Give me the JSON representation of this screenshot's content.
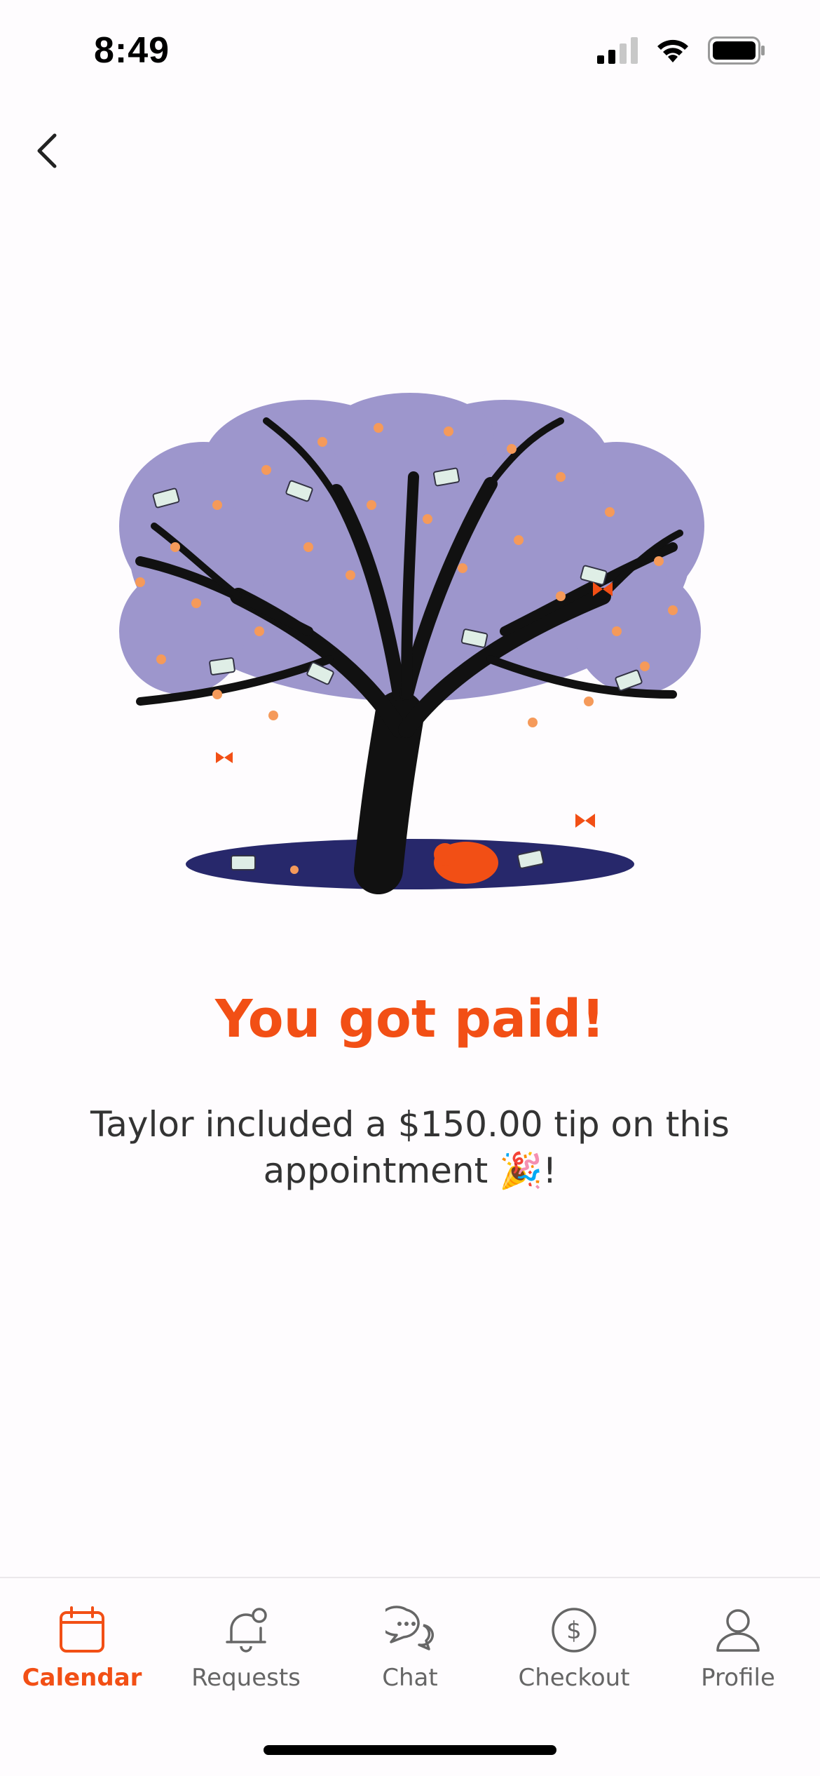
{
  "status_bar": {
    "time": "8:49"
  },
  "header": {
    "back_icon": "chevron-left-icon"
  },
  "content": {
    "illustration": "money-tree-illustration",
    "headline": "You got paid!",
    "message": "Taylor included a $150.00 tip on this appointment",
    "message_emoji": "🎉",
    "message_end": "!"
  },
  "tab_bar": {
    "tabs": [
      {
        "label": "Calendar",
        "icon": "calendar-icon",
        "active": true
      },
      {
        "label": "Requests",
        "icon": "bell-icon",
        "active": false
      },
      {
        "label": "Chat",
        "icon": "chat-bubbles-icon",
        "active": false
      },
      {
        "label": "Checkout",
        "icon": "dollar-circle-icon",
        "active": false
      },
      {
        "label": "Profile",
        "icon": "person-icon",
        "active": false
      }
    ]
  },
  "colors": {
    "accent": "#f24f15",
    "tree_foliage": "#9d96cc",
    "ground": "#27286b"
  }
}
